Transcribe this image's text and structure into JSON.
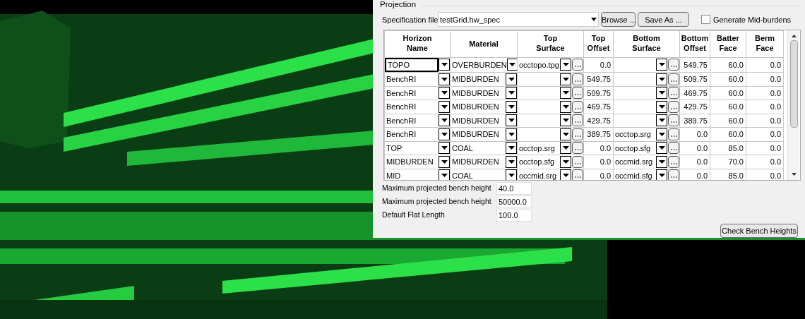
{
  "panel": {
    "title": "Projection",
    "spec_label": "Specification file",
    "spec_value": "testGrid.hw_spec",
    "browse": "Browse ...",
    "save_as": "Save As ...",
    "mid_burdens": {
      "label": "Generate Mid-burdens",
      "checked": false
    }
  },
  "table": {
    "columns": [
      {
        "label": "Horizon\nName",
        "kind": "combo"
      },
      {
        "label": "Material",
        "kind": "combo"
      },
      {
        "label": "Top\nSurface",
        "kind": "file"
      },
      {
        "label": "Top\nOffset",
        "kind": "number"
      },
      {
        "label": "Bottom\nSurface",
        "kind": "file"
      },
      {
        "label": "Bottom\nOffset",
        "kind": "number"
      },
      {
        "label": "Batter\nFace",
        "kind": "number"
      },
      {
        "label": "Berm\nFace",
        "kind": "number"
      }
    ],
    "rows": [
      {
        "selected": true,
        "cells": [
          "TOPO",
          "OVERBURDEN",
          "occtopo.tpg",
          "0.0",
          "",
          "549.75",
          "60.0",
          "0.0"
        ]
      },
      {
        "selected": false,
        "cells": [
          "BenchRI",
          "MIDBURDEN",
          "",
          "549.75",
          "",
          "509.75",
          "60.0",
          "0.0"
        ]
      },
      {
        "selected": false,
        "cells": [
          "BenchRI",
          "MIDBURDEN",
          "",
          "509.75",
          "",
          "469.75",
          "60.0",
          "0.0"
        ]
      },
      {
        "selected": false,
        "cells": [
          "BenchRI",
          "MIDBURDEN",
          "",
          "469.75",
          "",
          "429.75",
          "60.0",
          "0.0"
        ]
      },
      {
        "selected": false,
        "cells": [
          "BenchRI",
          "MIDBURDEN",
          "",
          "429.75",
          "",
          "389.75",
          "60.0",
          "0.0"
        ]
      },
      {
        "selected": false,
        "cells": [
          "BenchRI",
          "MIDBURDEN",
          "",
          "389.75",
          "occtop.srg",
          "0.0",
          "60.0",
          "0.0"
        ]
      },
      {
        "selected": false,
        "cells": [
          "TOP",
          "COAL",
          "occtop.srg",
          "0.0",
          "occtop.sfg",
          "0.0",
          "85.0",
          "0.0"
        ]
      },
      {
        "selected": false,
        "cells": [
          "MIDBURDEN",
          "MIDBURDEN",
          "occtop.sfg",
          "0.0",
          "occmid.srg",
          "0.0",
          "70.0",
          "0.0"
        ]
      },
      {
        "selected": false,
        "cells": [
          "MID",
          "COAL",
          "occmid.srg",
          "0.0",
          "occmid.sfg",
          "0.0",
          "85.0",
          "0.0"
        ]
      }
    ]
  },
  "fields": [
    {
      "label": "Maximum projected bench height",
      "value": "40.0"
    },
    {
      "label": "Maximum projected bench height",
      "value": "50000.0"
    },
    {
      "label": "Default Flat Length",
      "value": "100.0"
    }
  ],
  "check_button": "Check Bench Heights"
}
